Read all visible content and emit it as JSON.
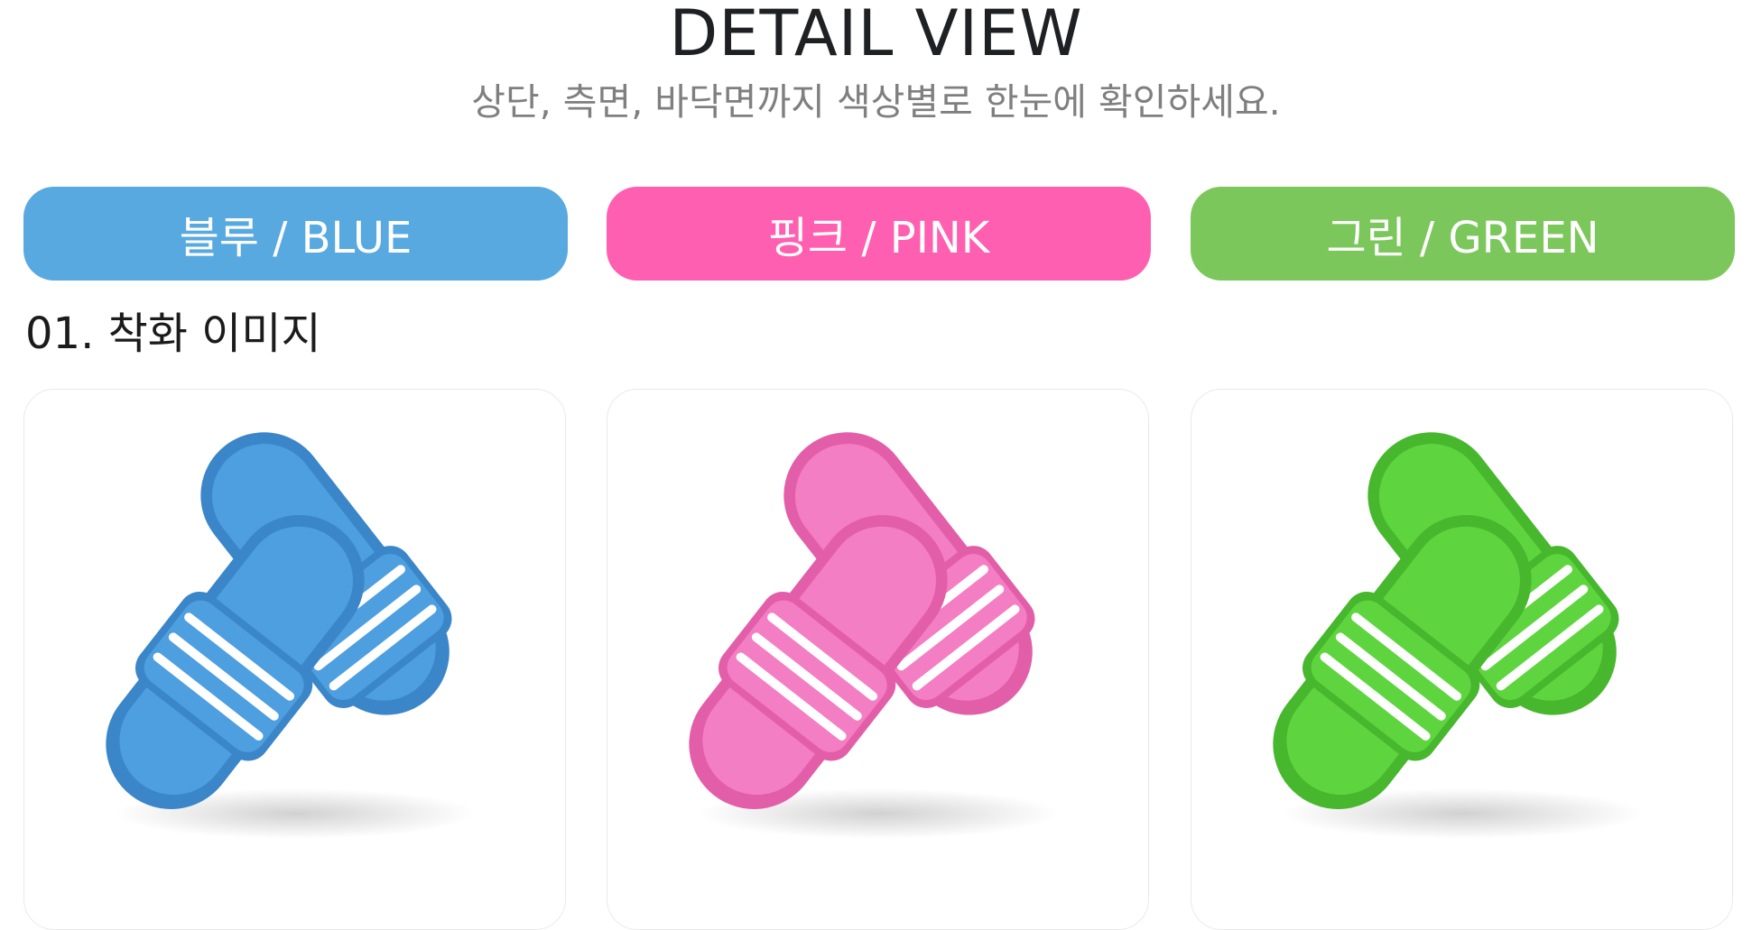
{
  "header": {
    "title": "DETAIL VIEW",
    "subtitle": "상단, 측면, 바닥면까지 색상별로 한눈에 확인하세요."
  },
  "color_options": [
    {
      "label": "블루 / BLUE",
      "color": "#58a9e0"
    },
    {
      "label": "핑크 / PINK",
      "color": "#ff5fb0"
    },
    {
      "label": "그린 / GREEN",
      "color": "#7cc75c"
    }
  ],
  "section": {
    "heading": "01. 착화 이미지"
  },
  "products": [
    {
      "icon": "blue-slipper-pair-image",
      "body_color": "#4d9fe0",
      "shade_color": "#3a86c8"
    },
    {
      "icon": "pink-slipper-pair-image",
      "body_color": "#f47ec3",
      "shade_color": "#e35ea9"
    },
    {
      "icon": "green-slipper-pair-image",
      "body_color": "#5ed53f",
      "shade_color": "#47b72d"
    }
  ]
}
